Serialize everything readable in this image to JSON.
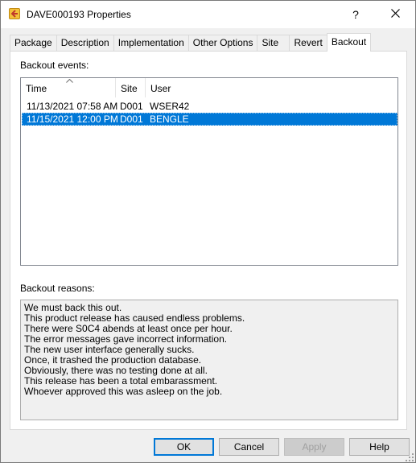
{
  "window": {
    "title": "DAVE000193 Properties",
    "help_label": "?"
  },
  "tabs": [
    {
      "label": "Package"
    },
    {
      "label": "Description"
    },
    {
      "label": "Implementation"
    },
    {
      "label": "Other Options"
    },
    {
      "label": "Site"
    },
    {
      "label": "Revert"
    },
    {
      "label": "Backout",
      "active": true
    }
  ],
  "events": {
    "label": "Backout events:",
    "columns": [
      "Time",
      "Site",
      "User"
    ],
    "sort_column": "Time",
    "rows": [
      {
        "time": "11/13/2021  07:58 AM",
        "site": "D001",
        "user": "WSER42"
      },
      {
        "time": "11/15/2021  12:00 PM",
        "site": "D001",
        "user": "BENGLE",
        "selected": true
      }
    ]
  },
  "reasons": {
    "label": "Backout reasons:",
    "lines": [
      "We must back this out.",
      "This product release has caused endless problems.",
      "There were S0C4 abends at least once per hour.",
      "The error messages gave incorrect information.",
      "The new user interface generally sucks.",
      "Once, it trashed the production database.",
      "Obviously, there was no testing done at all.",
      "This release has been a total embarassment.",
      "Whoever approved this was asleep on the job."
    ]
  },
  "buttons": {
    "ok": "OK",
    "cancel": "Cancel",
    "apply": "Apply",
    "help": "Help"
  },
  "colors": {
    "selection": "#0078d7",
    "default_button_border": "#0078d7"
  }
}
